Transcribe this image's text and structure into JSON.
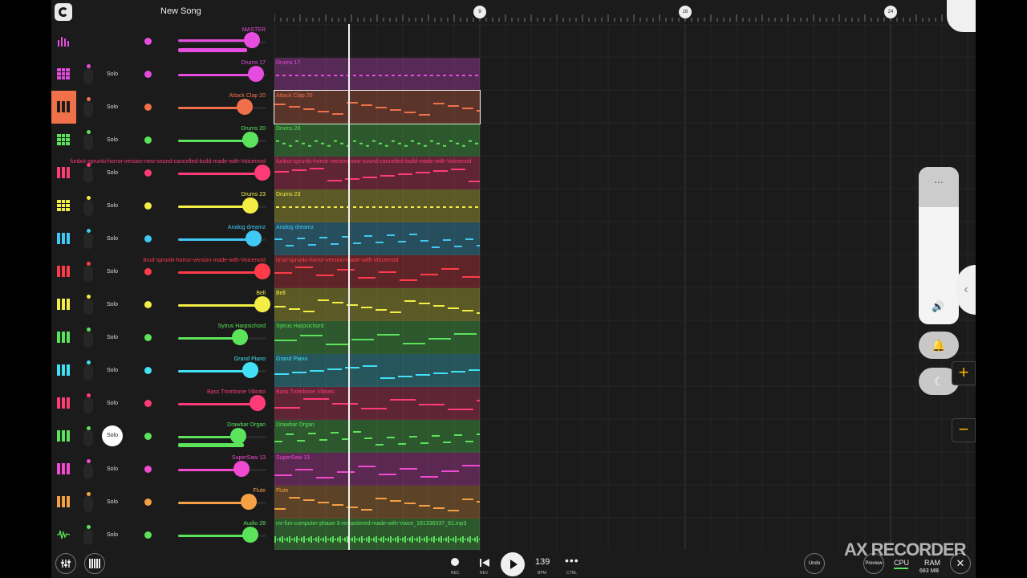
{
  "header": {
    "title": "New Song"
  },
  "ruler": {
    "markers": [
      "9",
      "16",
      "24"
    ]
  },
  "master": {
    "label": "MASTER",
    "color": "#e74ee0"
  },
  "tracks": [
    {
      "name": "Drums 17",
      "color": "#e64be0",
      "icon": "drum-grid-icon",
      "fill": 0.88
    },
    {
      "name": "Attack Clap 20",
      "color": "#f0704a",
      "icon": "piano-keys-icon",
      "fill": 0.75,
      "selected": true
    },
    {
      "name": "Drums 20",
      "color": "#5be35b",
      "icon": "drum-grid-icon",
      "fill": 0.82
    },
    {
      "name": "funbot-sprunki-horror-version-new-sound-cancelled-build-made-with-Voicemod",
      "color": "#ff3b78",
      "icon": "piano-keys-icon",
      "fill": 0.95
    },
    {
      "name": "Drums 23",
      "color": "#f2ee45",
      "icon": "drum-grid-icon",
      "fill": 0.82
    },
    {
      "name": "Analog dreamz",
      "color": "#42c8f5",
      "icon": "piano-keys-icon",
      "fill": 0.85
    },
    {
      "name": "brud-sprunki-horror-version-made-with-Voicemod",
      "color": "#ff3b4a",
      "icon": "piano-keys-icon",
      "fill": 0.95
    },
    {
      "name": "Bell",
      "color": "#f2ee45",
      "icon": "piano-keys-icon",
      "fill": 0.95
    },
    {
      "name": "Sytrus Harpsichord",
      "color": "#5be35b",
      "icon": "piano-keys-icon",
      "fill": 0.7
    },
    {
      "name": "Grand Piano",
      "color": "#42e0f5",
      "icon": "piano-keys-icon",
      "fill": 0.82
    },
    {
      "name": "Bass Trombone Vibrato",
      "color": "#ff3b78",
      "icon": "piano-keys-icon",
      "fill": 0.9
    },
    {
      "name": "Drawbar Organ",
      "color": "#5be35b",
      "icon": "piano-keys-icon",
      "fill": 0.68,
      "solo_active": true
    },
    {
      "name": "SuperSaw 13",
      "color": "#f04ad0",
      "icon": "piano-keys-icon",
      "fill": 0.72
    },
    {
      "name": "Flute",
      "color": "#f5a044",
      "icon": "piano-keys-icon",
      "fill": 0.8
    },
    {
      "name": "Audio 28",
      "color": "#5be35b",
      "icon": "waveform-icon",
      "fill": 0.82
    }
  ],
  "clips": [
    "Drums 17",
    "Attack Clap 20",
    "Drums 20",
    "funbot-sprunki-horror-version-new-sound-cancelled-build-made-with-Voicemod",
    "Drums 23",
    "Analog dreamz",
    "brud-sprunki-horror-version-made-with-Voicemod",
    "Bell",
    "Sytrus Harpsichord",
    "Grand Piano",
    "Bass Trombone Vibrato",
    "Drawbar Organ",
    "SuperSaw 13",
    "Flute",
    "mr-fun-computer-phase-3-remastered-made-with-Voice_181336337_81.mp3"
  ],
  "solo_label": "Solo",
  "transport": {
    "rec_label": "REC",
    "rev_label": "REV",
    "bpm": "139",
    "bpm_label": "BPM",
    "ctrl_label": "CTRL"
  },
  "bottom_right": {
    "undo": "Undo",
    "preview": "Preview",
    "cpu": "CPU",
    "ram": "RAM",
    "ram_value": "683 MB"
  },
  "watermark": "AX RECORDER",
  "overlay": {
    "menu_dots": "...",
    "plus": "+",
    "minus": "−"
  }
}
